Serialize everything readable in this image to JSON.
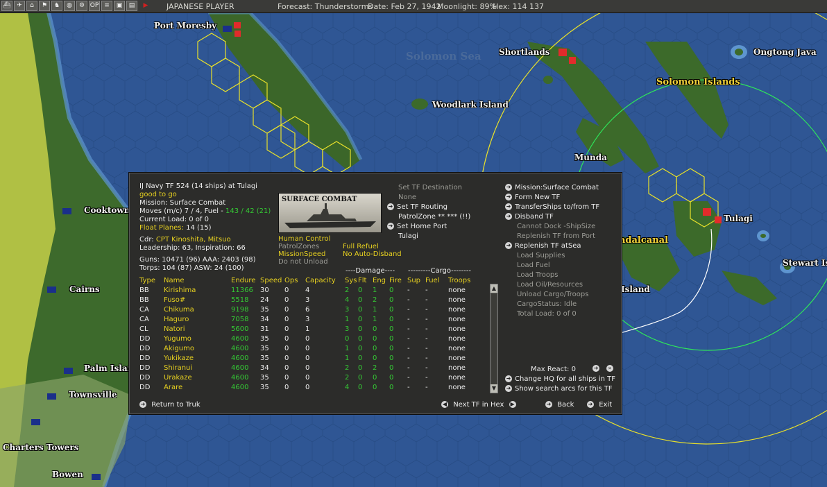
{
  "topbar": {
    "player": "JAPANESE PLAYER",
    "forecast": "Forecast: Thunderstorms",
    "date": "Date: Feb 27, 1942",
    "moonlight": "Moonlight: 89%",
    "hex": "Hex: 114 137",
    "buttons": [
      "OP"
    ]
  },
  "map": {
    "labels": {
      "port_moresby": "Port Moresby",
      "solomon_sea": "Solomon Sea",
      "shortlands": "Shortlands",
      "ongtong_java": "Ongtong Java",
      "solomon_islands": "Solomon Islands",
      "woodlark_island": "Woodlark Island",
      "munda": "Munda",
      "tulagi": "Tulagi",
      "guadalcanal": "adalcanal",
      "stewart": "Stewart Isl",
      "island": "Island",
      "cooktown": "Cooktown",
      "cairns": "Cairns",
      "palm_island": "Palm Islan",
      "townsville": "Townsville",
      "charters_towers": "Charters Towers",
      "bowen": "Bowen"
    },
    "colors": {
      "ocean": "#2f5694",
      "shallow": "#4a7fbf",
      "land": "#3f6a2e",
      "range_yellow": "#e8e02a",
      "range_green": "#2ee65a"
    }
  },
  "panel": {
    "header": {
      "tf_title": "IJ Navy TF 524 (14 ships) at Tulagi",
      "status": "good to go",
      "mission": "Mission: Surface Combat",
      "moves_prefix": "Moves (m/c) 7 / 4, Fuel - ",
      "moves_fuel": "143 / 42 (21)",
      "current_load": "Current Load: 0 of 0",
      "float_planes_label": "Float Planes:",
      "float_planes_value": "14 (15)",
      "cdr_label": "Cdr:",
      "cdr_name": "CPT Kinoshita, Mitsuo",
      "leadership": "Leadership: 63, Inspiration: 66",
      "guns": "Guns: 10471 (96)  AAA: 2403 (98)",
      "torps": "Torps: 104 (87)   ASW: 24 (100)"
    },
    "thumb_title": "SURFACE COMBAT",
    "middle": {
      "set_destination": "Set TF Destination",
      "destination_value": "None",
      "set_routing": "Set TF Routing",
      "patrol_zone": "PatrolZone ** *** (!!)",
      "set_home_port": "Set Home Port",
      "home_port_value": "Tulagi"
    },
    "flags": {
      "human_control": "Human Control",
      "patrol_zones": "PatrolZones",
      "mission_speed": "MissionSpeed",
      "do_not_unload": "Do not Unload",
      "full_refuel": "Full Refuel",
      "no_auto_disband": "No Auto-Disband"
    },
    "commands": {
      "mission": "Mission:Surface Combat",
      "form_new": "Form New TF",
      "transfer": "TransferShips to/from TF",
      "disband": "Disband TF",
      "cannot_dock": "Cannot Dock -ShipSize",
      "replenish_port": "Replenish TF from Port",
      "replenish_sea": "Replenish TF atSea",
      "load_supplies": "Load Supplies",
      "load_fuel": "Load Fuel",
      "load_troops": "Load Troops",
      "load_oil": "Load Oil/Resources",
      "unload_cargo": "Unload Cargo/Troops",
      "cargo_status": "CargoStatus: Idle",
      "total_load": "Total Load: 0 of 0"
    },
    "table": {
      "group_damage": "----Damage----",
      "group_cargo": "---------Cargo--------",
      "columns": [
        "Type",
        "Name",
        "Endure",
        "Speed",
        "Ops",
        "Capacity",
        "Sys",
        "Flt",
        "Eng",
        "Fire",
        "Sup",
        "Fuel",
        "Troops"
      ],
      "rows": [
        {
          "type": "BB",
          "name": "Kirishima",
          "endure": "11366",
          "speed": "30",
          "ops": "0",
          "capacity": "4",
          "sys": "2",
          "flt": "0",
          "eng": "1",
          "fire": "0",
          "sup": "-",
          "fuel": "-",
          "troops": "none"
        },
        {
          "type": "BB",
          "name": "Fuso#",
          "endure": "5518",
          "speed": "24",
          "ops": "0",
          "capacity": "3",
          "sys": "4",
          "flt": "0",
          "eng": "2",
          "fire": "0",
          "sup": "-",
          "fuel": "-",
          "troops": "none"
        },
        {
          "type": "CA",
          "name": "Chikuma",
          "endure": "9198",
          "speed": "35",
          "ops": "0",
          "capacity": "6",
          "sys": "3",
          "flt": "0",
          "eng": "1",
          "fire": "0",
          "sup": "-",
          "fuel": "-",
          "troops": "none"
        },
        {
          "type": "CA",
          "name": "Haguro",
          "endure": "7058",
          "speed": "34",
          "ops": "0",
          "capacity": "3",
          "sys": "1",
          "flt": "0",
          "eng": "1",
          "fire": "0",
          "sup": "-",
          "fuel": "-",
          "troops": "none"
        },
        {
          "type": "CL",
          "name": "Natori",
          "endure": "5600",
          "speed": "31",
          "ops": "0",
          "capacity": "1",
          "sys": "3",
          "flt": "0",
          "eng": "0",
          "fire": "0",
          "sup": "-",
          "fuel": "-",
          "troops": "none"
        },
        {
          "type": "DD",
          "name": "Yugumo",
          "endure": "4600",
          "speed": "35",
          "ops": "0",
          "capacity": "0",
          "sys": "0",
          "flt": "0",
          "eng": "0",
          "fire": "0",
          "sup": "-",
          "fuel": "-",
          "troops": "none"
        },
        {
          "type": "DD",
          "name": "Akigumo",
          "endure": "4600",
          "speed": "35",
          "ops": "0",
          "capacity": "0",
          "sys": "1",
          "flt": "0",
          "eng": "0",
          "fire": "0",
          "sup": "-",
          "fuel": "-",
          "troops": "none"
        },
        {
          "type": "DD",
          "name": "Yukikaze",
          "endure": "4600",
          "speed": "35",
          "ops": "0",
          "capacity": "0",
          "sys": "1",
          "flt": "0",
          "eng": "0",
          "fire": "0",
          "sup": "-",
          "fuel": "-",
          "troops": "none"
        },
        {
          "type": "DD",
          "name": "Shiranui",
          "endure": "4600",
          "speed": "34",
          "ops": "0",
          "capacity": "0",
          "sys": "2",
          "flt": "0",
          "eng": "2",
          "fire": "0",
          "sup": "-",
          "fuel": "-",
          "troops": "none"
        },
        {
          "type": "DD",
          "name": "Urakaze",
          "endure": "4600",
          "speed": "35",
          "ops": "0",
          "capacity": "0",
          "sys": "2",
          "flt": "0",
          "eng": "0",
          "fire": "0",
          "sup": "-",
          "fuel": "-",
          "troops": "none"
        },
        {
          "type": "DD",
          "name": "Arare",
          "endure": "4600",
          "speed": "35",
          "ops": "0",
          "capacity": "0",
          "sys": "4",
          "flt": "0",
          "eng": "0",
          "fire": "0",
          "sup": "-",
          "fuel": "-",
          "troops": "none"
        }
      ]
    },
    "bottom": {
      "max_react": "Max React: 0",
      "change_hq": "Change HQ for all ships in TF",
      "search_arcs": "Show search arcs for this TF",
      "return_to": "Return to Truk",
      "next_tf": "Next TF in Hex",
      "back": "Back",
      "exit": "Exit"
    }
  }
}
